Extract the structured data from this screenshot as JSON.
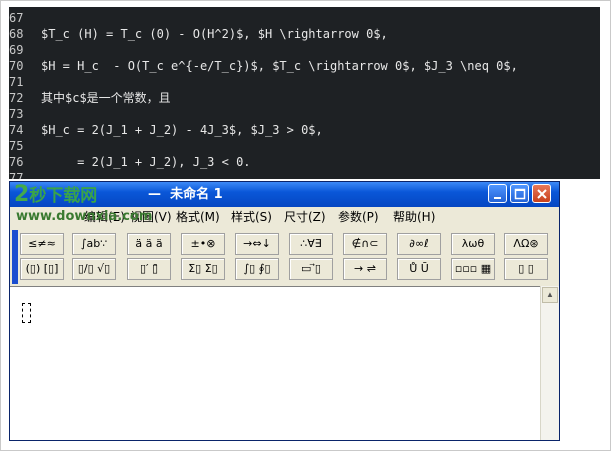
{
  "code_editor": {
    "lines": [
      {
        "num": "67",
        "text": ""
      },
      {
        "num": "68",
        "text": "$T_c (H) = T_c (0) - O(H^2)$, $H \\rightarrow 0$,"
      },
      {
        "num": "69",
        "text": ""
      },
      {
        "num": "70",
        "text": "$H = H_c  - O(T_c e^{-e/T_c})$, $T_c \\rightarrow 0$, $J_3 \\neq 0$,"
      },
      {
        "num": "71",
        "text": ""
      },
      {
        "num": "72",
        "text": "其中$c$是一个常数，且"
      },
      {
        "num": "73",
        "text": ""
      },
      {
        "num": "74",
        "text": "$H_c = 2(J_1 + J_2) - 4J_3$, $J_3 > 0$,"
      },
      {
        "num": "75",
        "text": ""
      },
      {
        "num": "76",
        "text": "     = 2(J_1 + J_2), J_3 < 0."
      },
      {
        "num": "77",
        "text": ""
      }
    ]
  },
  "window": {
    "watermark_num": "2",
    "watermark_text": "秒下载网",
    "watermark_url": "www.downxia.com",
    "title": "未命名 1",
    "title_sep": "—",
    "controls": [
      "minimize",
      "maximize",
      "close"
    ]
  },
  "menu": {
    "items": [
      "编辑(E)",
      "视图(V)",
      "格式(M)",
      "样式(S)",
      "尺寸(Z)",
      "参数(P)",
      "帮助(H)"
    ]
  },
  "toolbar": {
    "row1": [
      {
        "label": "≤≠≈",
        "icon": "relations-palette-icon"
      },
      {
        "label": "∫ab∵",
        "icon": "spaces-palette-icon"
      },
      {
        "label": "ä ä ä",
        "icon": "embellishments-palette-icon"
      },
      {
        "label": "±•⊗",
        "icon": "operators-palette-icon"
      },
      {
        "label": "→⇔↓",
        "icon": "arrows-palette-icon"
      },
      {
        "label": "∴∀∃",
        "icon": "logic-palette-icon"
      },
      {
        "label": "∉∩⊂",
        "icon": "sets-palette-icon"
      },
      {
        "label": "∂∞ℓ",
        "icon": "misc-symbols-palette-icon"
      },
      {
        "label": "λωθ",
        "icon": "greek-lower-palette-icon"
      },
      {
        "label": "ΛΩ⊛",
        "icon": "greek-upper-palette-icon"
      }
    ],
    "row2": [
      {
        "label": "(▯) [▯]",
        "icon": "fences-palette-icon"
      },
      {
        "label": "▯/▯ √▯",
        "icon": "fractions-radicals-palette-icon"
      },
      {
        "label": "▯′ ▯̄",
        "icon": "scripts-palette-icon"
      },
      {
        "label": "Σ▯ Σ▯",
        "icon": "summation-palette-icon"
      },
      {
        "label": "∫▯ ∮▯",
        "icon": "integrals-palette-icon"
      },
      {
        "label": "▭ ⃗▯",
        "icon": "underbars-overbars-palette-icon"
      },
      {
        "label": "→ ⇌",
        "icon": "labeled-arrows-palette-icon"
      },
      {
        "label": "Ů Ū",
        "icon": "products-palette-icon"
      },
      {
        "label": "▫▫▫ ▦",
        "icon": "matrices-palette-icon"
      },
      {
        "label": "▯ ▯",
        "icon": "templates-palette-icon"
      }
    ]
  },
  "colors": {
    "code_bg": "#1e2124",
    "title_blue": "#0a57d8",
    "menu_bg": "#ece9d8",
    "toolbar_grip": "#1b4dd0",
    "close_red": "#c7401c"
  }
}
